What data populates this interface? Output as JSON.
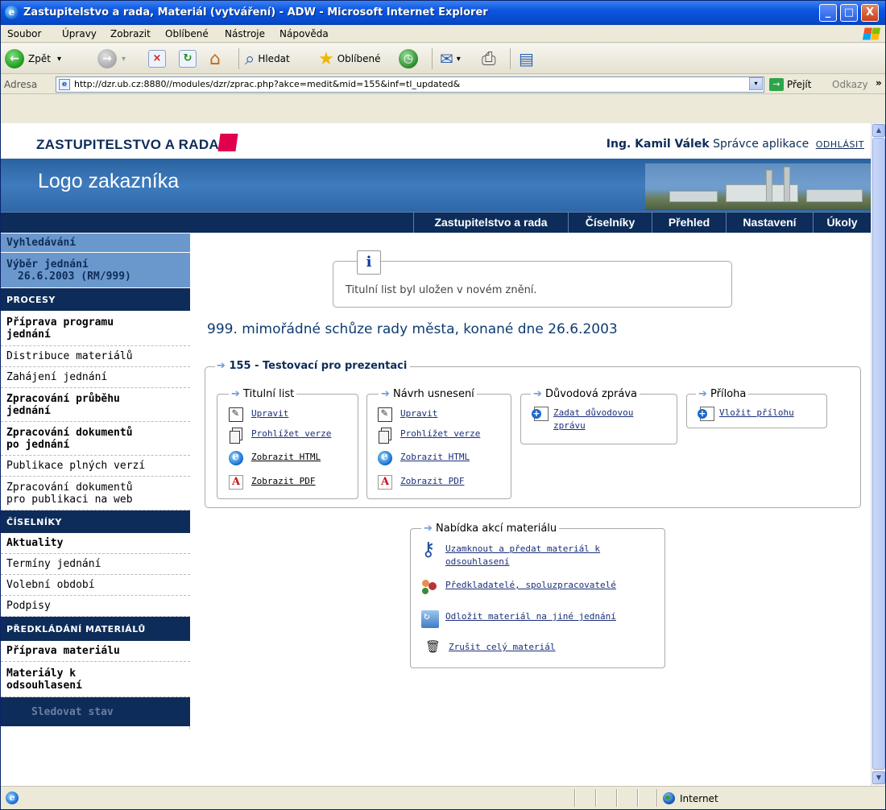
{
  "window": {
    "title": "Zastupitelstvo a rada, Materiál (vytváření) - ADW - Microsoft Internet Explorer",
    "ie_glyph": "e",
    "min_glyph": "_",
    "max_glyph": "□",
    "close_glyph": "X"
  },
  "menu": [
    "Soubor",
    "Úpravy",
    "Zobrazit",
    "Oblíbené",
    "Nástroje",
    "Nápověda"
  ],
  "toolbar": {
    "back": "Zpět",
    "back_glyph": "←",
    "forward_glyph": "→",
    "dropdown_glyph": "▾",
    "stop_glyph": "×",
    "refresh_glyph": "↻",
    "home_glyph": "⌂",
    "search": "Hledat",
    "search_glyph": "⌕",
    "favorites": "Oblíbené",
    "favorites_glyph": "★",
    "history_glyph": "◷",
    "mail_glyph": "✉",
    "print_glyph": "⎙",
    "edit_glyph": "▤"
  },
  "address": {
    "label": "Adresa",
    "url": "http://dzr.ub.cz:8880//modules/dzr/zprac.php?akce=medit&mid=155&inf=tl_updated&",
    "page_glyph": "e",
    "dropdown_glyph": "▾",
    "go": "Přejít",
    "go_glyph": "→",
    "links": "Odkazy",
    "more_glyph": "»"
  },
  "header": {
    "app_name": "ZASTUPITELSTVO A RADA",
    "user": "Ing. Kamil Válek",
    "role": "Správce aplikace",
    "logout": "ODHLÁSIT",
    "logo": "Logo zakazníka"
  },
  "nav": [
    "Zastupitelstvo a rada",
    "Číselníky",
    "Přehled",
    "Nastavení",
    "Úkoly"
  ],
  "sidebar": {
    "search": "Vyhledávání",
    "meeting_select": [
      "Výběr jednání",
      "26.6.2003 (RM/999)"
    ],
    "procesy_head": "PROCESY",
    "procesy": [
      [
        "Příprava programu",
        "jednání"
      ],
      [
        "Distribuce materiálů"
      ],
      [
        "Zahájení jednání"
      ],
      [
        "Zpracování průběhu",
        "jednání"
      ],
      [
        "Zpracování dokumentů",
        "po jednání"
      ],
      [
        "Publikace plných verzí"
      ],
      [
        "Zpracování dokumentů",
        "pro publikaci na web"
      ]
    ],
    "ciselniky_head": "ČÍSELNÍKY",
    "ciselniky": [
      "Aktuality",
      "Termíny jednání",
      "Volební období",
      "Podpisy"
    ],
    "predkladani_head": "PŘEDKLÁDÁNÍ MATERIÁLŮ",
    "predkladani": [
      [
        "Příprava materiálu"
      ],
      [
        "Materiály k",
        "odsouhlasení"
      ]
    ],
    "track": "Sledovat stav"
  },
  "content": {
    "info_glyph": "i",
    "info_message": "Titulní list byl uložen v novém znění.",
    "meeting_title": "999. mimořádné schůze rady města, konané dne 26.6.2003",
    "arrow_glyph": "➔",
    "material_title": "155 - Testovací pro prezentaci",
    "titulni_list": {
      "title": "Titulní list",
      "actions": [
        "Upravit",
        "Prohlížet verze",
        "Zobrazit HTML",
        "Zobrazit PDF"
      ]
    },
    "navrh_usneseni": {
      "title": "Návrh usnesení",
      "actions": [
        "Upravit",
        "Prohlížet verze",
        "Zobrazit HTML",
        "Zobrazit PDF"
      ]
    },
    "duvodova_zprava": {
      "title": "Důvodová zpráva",
      "action": [
        "Zadat důvodovou",
        "zprávu"
      ]
    },
    "priloha": {
      "title": "Příloha",
      "action": "Vložit přílohu"
    },
    "nabidka": {
      "title": "Nabídka akcí materiálu",
      "actions": [
        [
          "Uzamknout a předat materiál k",
          "odsouhlasení"
        ],
        [
          "Předkladatelé, spoluzpracovatelé"
        ],
        [
          "Odložit materiál na jiné jednání"
        ],
        [
          "Zrušit celý materiál"
        ]
      ]
    }
  },
  "status": {
    "zone": "Internet"
  },
  "scroll": {
    "up_glyph": "▲",
    "down_glyph": "▼"
  }
}
